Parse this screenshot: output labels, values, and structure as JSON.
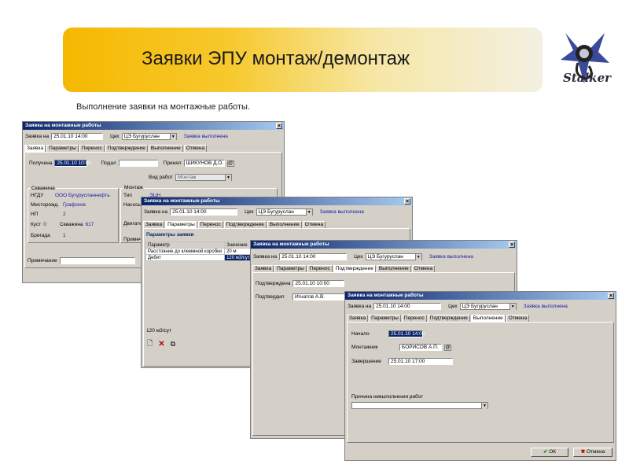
{
  "slide": {
    "title": "Заявки ЭПУ монтаж/демонтаж",
    "subtitle": "Выполнение заявки на монтажные работы.",
    "logo_text": "Stalker"
  },
  "w1": {
    "title": "Заявка на монтажные работы",
    "request_label": "Заявка на",
    "request_date": "25.01.10 14:00",
    "shop_label": "Цех",
    "shop_value": "ЦЭ Бугуруслан",
    "status": "Заявка выполнена",
    "tabs": [
      "Заявка",
      "Параметры",
      "Перенос",
      "Подтверждение",
      "Выполнение",
      "Отмена"
    ],
    "received_label": "Получена",
    "received_value": "25.01.10 10:00",
    "submitted_label": "Подал",
    "accepted_label": "Принял",
    "accepted_value": "ШИКУНОВ Д.О.",
    "worktype_label": "Вид работ",
    "worktype_value": "Монтаж",
    "well_group": "Скважина",
    "ngdu_label": "НГДУ",
    "ngdu_value": "ООО Бугурусланнефть",
    "field_label": "Месторожд.",
    "field_value": "Графское",
    "np_label": "НП",
    "np_value": "2",
    "bush_label": "Куст",
    "bush_value": "0",
    "well_label": "Скважина",
    "well_value": "617",
    "brigade_label": "Бригада",
    "brigade_value": "1",
    "mount_group": "Монтаж",
    "type_label": "Тип",
    "type_value": "ЭЦН",
    "pump_label": "Насосы",
    "engine_label": "Двигате",
    "note_label": "Примеча",
    "remark_label": "Примечание"
  },
  "w2": {
    "title": "Заявка на монтажные работы",
    "request_label": "Заявка на",
    "request_date": "25.01.10 14:00",
    "shop_label": "Цех",
    "shop_value": "ЦЭ Бугуруслан",
    "status": "Заявка выполнена",
    "tabs": [
      "Заявка",
      "Параметры",
      "Перенос",
      "Подтверждение",
      "Выполнение",
      "Отмена"
    ],
    "params_heading": "Параметры заявки",
    "col_param": "Параметр",
    "col_value": "Значение",
    "rows": [
      {
        "param": "Расстояние до клеммной коробки",
        "value": "20 м"
      },
      {
        "param": "Дебит",
        "value": "120 м3/сут"
      }
    ],
    "footer_value": "120 м3/сут"
  },
  "w3": {
    "title": "Заявка на монтажные работы",
    "request_label": "Заявка на",
    "request_date": "25.01.10 14:00",
    "shop_label": "Цех",
    "shop_value": "ЦЭ Бугуруслан",
    "status": "Заявка выполнена",
    "tabs": [
      "Заявка",
      "Параметры",
      "Перенос",
      "Подтверждение",
      "Выполнение",
      "Отмена"
    ],
    "confirmed_label": "Подтверждена",
    "confirmed_value": "25.01.10 10:00",
    "confirmer_label": "Подтвердил",
    "confirmer_value": "Игнатов А.В."
  },
  "w4": {
    "title": "Заявка на монтажные работы",
    "request_label": "Заявка на",
    "request_date": "25.01.10 14:00",
    "shop_label": "Цех",
    "shop_value": "ЦЭ Бугуруслан",
    "status": "Заявка выполнена",
    "tabs": [
      "Заявка",
      "Параметры",
      "Перенос",
      "Подтверждение",
      "Выполнение",
      "Отмена"
    ],
    "start_label": "Начало",
    "start_value": "25.01.10 14:00",
    "installer_label": "Монтажник",
    "installer_value": "БОРИСОВ А.П.",
    "end_label": "Завершение",
    "end_value": "25.01.10 17:00",
    "reason_label": "Причина невыполнения работ",
    "ok_label": "ОК",
    "cancel_label": "Отмена"
  }
}
